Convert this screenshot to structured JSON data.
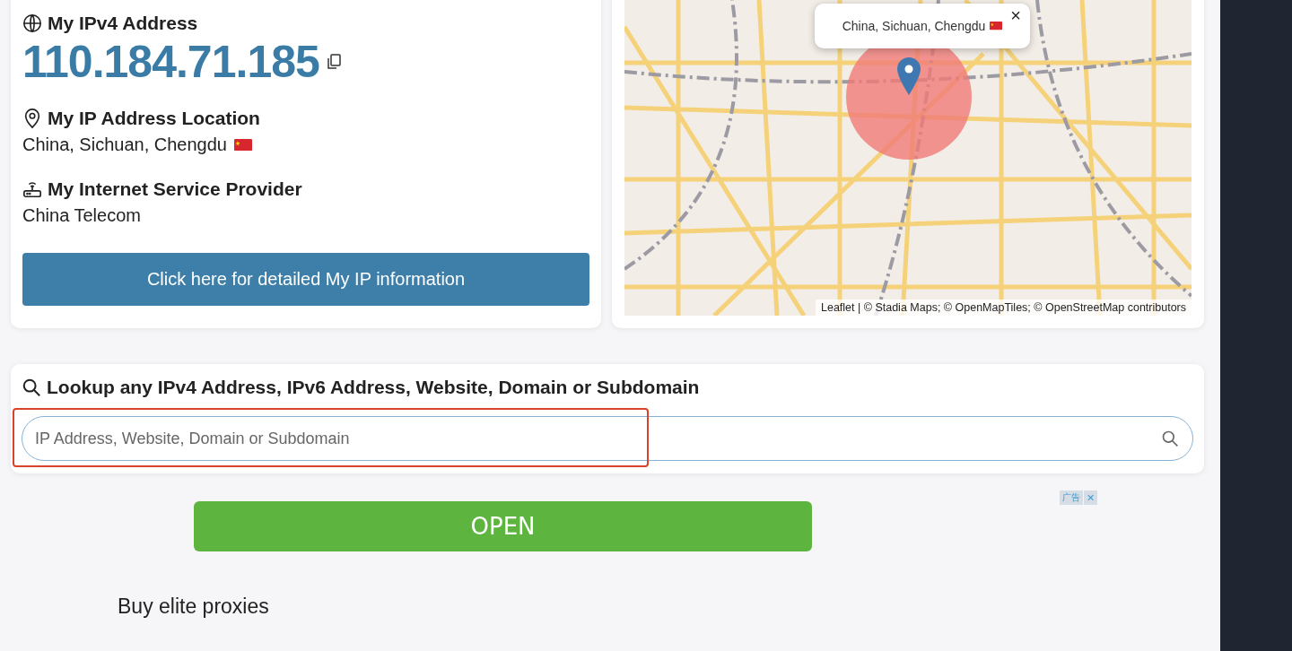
{
  "ip_card": {
    "sections": [
      {
        "kind": "address",
        "heading": "My IPv4 Address",
        "value": "110.184.71.185"
      },
      {
        "kind": "location",
        "heading": "My IP Address Location",
        "value": "China, Sichuan, Chengdu"
      },
      {
        "kind": "isp",
        "heading": "My Internet Service Provider",
        "value": "China Telecom"
      }
    ],
    "button": "Click here for detailed My IP information"
  },
  "map": {
    "popup": {
      "text": "China, Sichuan, Chengdu",
      "close": "×"
    },
    "attribution": "Leaflet | © Stadia Maps; © OpenMapTiles; © OpenStreetMap contributors"
  },
  "lookup": {
    "heading": "Lookup any IPv4 Address, IPv6 Address, Website, Domain or Subdomain",
    "placeholder": "IP Address, Website, Domain or Subdomain"
  },
  "ad": {
    "button": "OPEN",
    "label": "广告",
    "close": "✕"
  },
  "footer_text": "Buy elite proxies"
}
